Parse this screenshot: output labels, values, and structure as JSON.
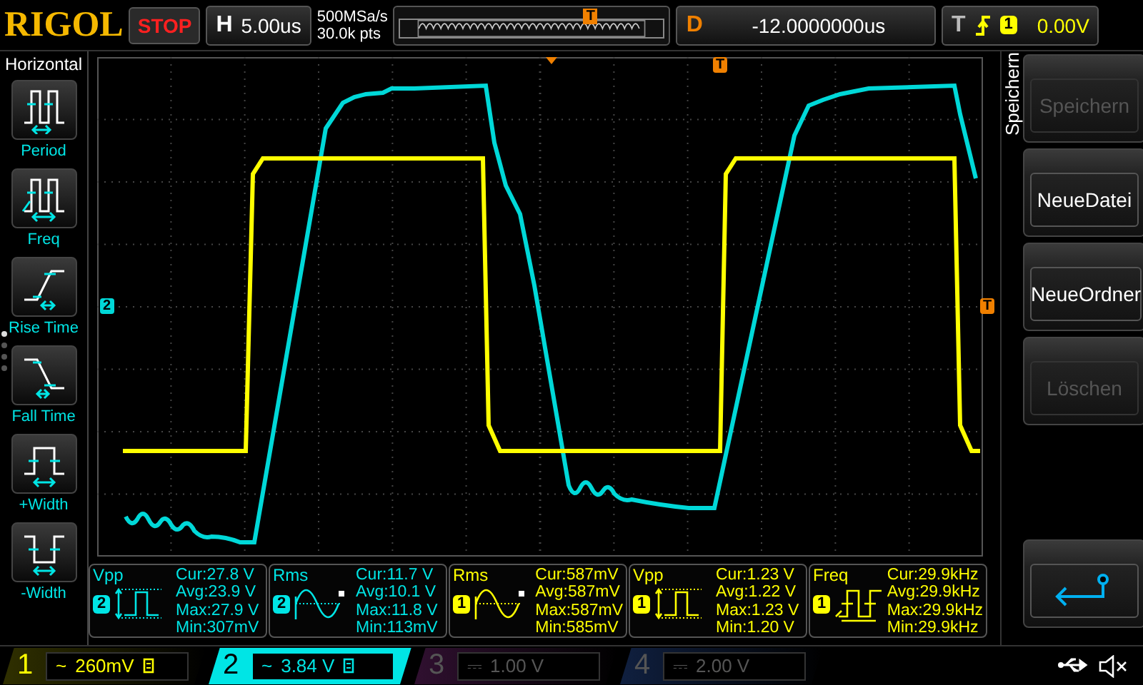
{
  "top_bar": {
    "logo": "RIGOL",
    "run_state": "STOP",
    "timebase": {
      "label": "H",
      "value": "5.00us"
    },
    "sample_rate": "500MSa/s",
    "memory_depth": "30.0k pts",
    "overview_marker": "T",
    "delay": {
      "label": "D",
      "value": "-12.0000000us"
    },
    "trigger": {
      "label": "T",
      "source": "1",
      "level": "0.00V"
    }
  },
  "left_menu": {
    "title": "Horizontal",
    "pager": [
      {
        "selected": true
      },
      {
        "selected": false
      },
      {
        "selected": false
      },
      {
        "selected": false
      }
    ],
    "items": [
      {
        "label": "Period",
        "kind": "period"
      },
      {
        "label": "Freq",
        "kind": "freq"
      },
      {
        "label": "Rise Time",
        "kind": "rise"
      },
      {
        "label": "Fall Time",
        "kind": "fall"
      },
      {
        "label": "+Width",
        "kind": "pwidth"
      },
      {
        "label": "-Width",
        "kind": "nwidth"
      }
    ]
  },
  "scope": {
    "channel_marker": "2",
    "trigger_position_marker": "T",
    "trigger_level_marker": "T"
  },
  "right_menu": {
    "title": "Speichern",
    "buttons": [
      {
        "kind": "text",
        "label": "Speichern",
        "disabled": true
      },
      {
        "kind": "text",
        "label": "NeueDatei",
        "disabled": false
      },
      {
        "kind": "text",
        "label": "NeueOrdner",
        "disabled": false
      },
      {
        "kind": "text",
        "label": "Löschen",
        "disabled": true
      },
      {
        "kind": "back",
        "disabled": false
      }
    ]
  },
  "measurements": [
    {
      "type": "Vpp",
      "kind": "vpp",
      "channel": "2",
      "lines": [
        "Cur:27.8 V",
        "Avg:23.9 V",
        "Max:27.9 V",
        "Min:307mV"
      ]
    },
    {
      "type": "Rms",
      "kind": "rms",
      "channel": "2",
      "lines": [
        "Cur:11.7 V",
        "Avg:10.1 V",
        "Max:11.8 V",
        "Min:113mV"
      ]
    },
    {
      "type": "Rms",
      "kind": "rms",
      "channel": "1",
      "lines": [
        "Cur:587mV",
        "Avg:587mV",
        "Max:587mV",
        "Min:585mV"
      ]
    },
    {
      "type": "Vpp",
      "kind": "vpp",
      "channel": "1",
      "lines": [
        "Cur:1.23 V",
        "Avg:1.22 V",
        "Max:1.23 V",
        "Min:1.20 V"
      ]
    },
    {
      "type": "Freq",
      "kind": "freq",
      "channel": "1",
      "lines": [
        "Cur:29.9kHz",
        "Avg:29.9kHz",
        "Max:29.9kHz",
        "Min:29.9kHz"
      ]
    }
  ],
  "channels": [
    {
      "number": "1",
      "coupling": "~",
      "scale": "260mV",
      "on": true,
      "selected": false
    },
    {
      "number": "2",
      "coupling": "~",
      "scale": "3.84 V",
      "on": true,
      "selected": true
    },
    {
      "number": "3",
      "coupling": "⎓",
      "scale": "1.00 V",
      "on": false,
      "selected": false
    },
    {
      "number": "4",
      "coupling": "⎓",
      "scale": "2.00 V",
      "on": false,
      "selected": false
    }
  ]
}
